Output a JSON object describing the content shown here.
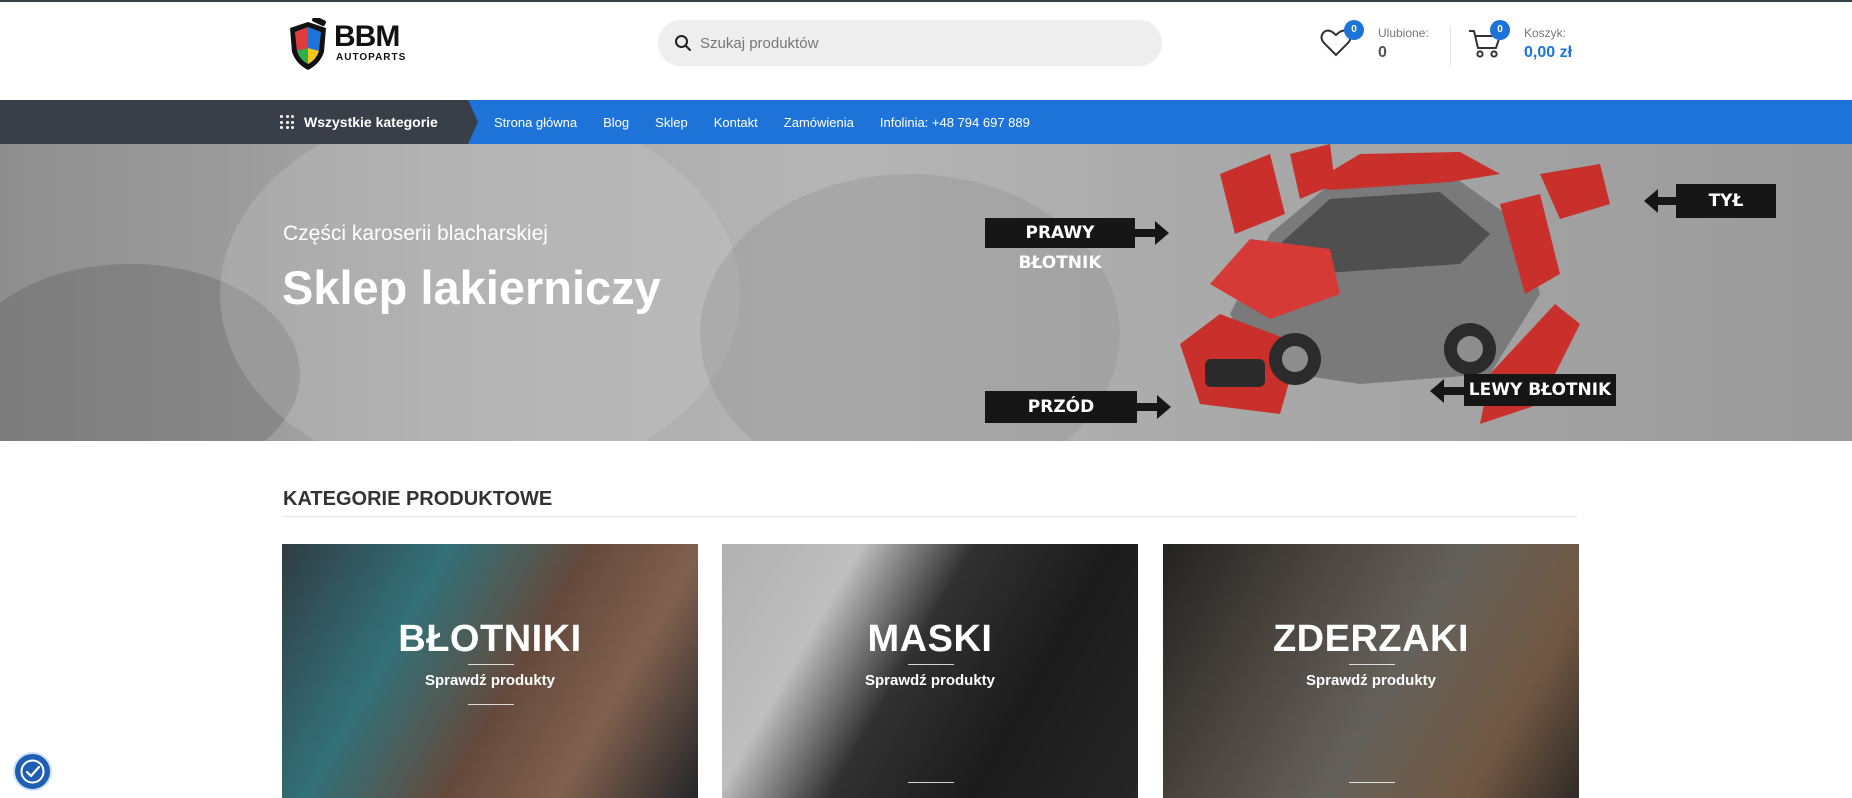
{
  "header": {
    "logo_text": "BBM",
    "logo_subtext": "AUTOPARTS",
    "search_placeholder": "Szukaj produktów",
    "wishlist": {
      "label": "Ulubione:",
      "value": "0",
      "badge": "0"
    },
    "cart": {
      "label": "Koszyk:",
      "value": "0,00 zł",
      "badge": "0"
    }
  },
  "nav": {
    "all_categories": "Wszystkie kategorie",
    "items": [
      {
        "label": "Strona główna"
      },
      {
        "label": "Blog"
      },
      {
        "label": "Sklep"
      },
      {
        "label": "Kontakt"
      },
      {
        "label": "Zamówienia"
      },
      {
        "label": "Infolinia: +48 794 697 889"
      }
    ]
  },
  "hero": {
    "subtitle": "Części karoserii blacharskiej",
    "title": "Sklep lakierniczy",
    "tags": {
      "right_fender": "PRAWY BŁOTNIK",
      "rear": "TYŁ",
      "front": "PRZÓD",
      "left_fender": "LEWY BŁOTNIK"
    }
  },
  "categories": {
    "heading": "KATEGORIE PRODUKTOWE",
    "cards": [
      {
        "title": "BŁOTNIKI",
        "link": "Sprawdź produkty"
      },
      {
        "title": "MASKI",
        "link": "Sprawdź produkty"
      },
      {
        "title": "ZDERZAKI",
        "link": "Sprawdź produkty"
      }
    ]
  },
  "colors": {
    "accent": "#1e73d8",
    "nav_dark": "#393f48"
  }
}
